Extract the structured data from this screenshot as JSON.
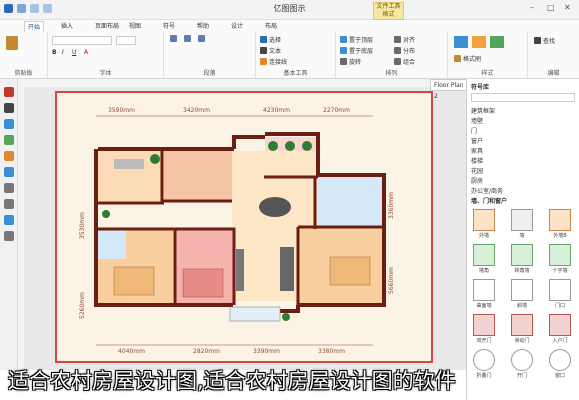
{
  "window": {
    "title": "亿图图示",
    "context_tab": "文件工具\n格式"
  },
  "tabs": {
    "file": "文件",
    "items": [
      "开始",
      "插入",
      "页面布局",
      "视图",
      "符号",
      "帮助",
      "设计",
      "布局"
    ],
    "active": 0
  },
  "ribbon": {
    "groups": [
      "剪贴板",
      "字体",
      "段落",
      "基本工具",
      "排列",
      "样式",
      "编辑"
    ],
    "buttons": [
      "选择",
      "文本",
      "连接线",
      "置于顶层",
      "置于底层",
      "对齐",
      "分布",
      "旋转",
      "组合",
      "格式刷",
      "查找"
    ]
  },
  "document": {
    "tab_label": "Floor Plan Design 2"
  },
  "floorplan": {
    "top_dims": [
      "3590mm",
      "3420mm",
      "4230mm",
      "2270mm"
    ],
    "bottom_dims": [
      "4040mm",
      "2820mm",
      "3390mm",
      "3380mm"
    ],
    "right_dims": [
      "3360mm",
      "5660mm"
    ],
    "left_dims": [
      "3530mm",
      "5260mm"
    ]
  },
  "right_panel": {
    "title": "符号库",
    "search_placeholder": "搜索",
    "categories": [
      "建筑框架",
      "墙壁",
      "门",
      "窗户",
      "家具",
      "楼梯",
      "花园",
      "厨房",
      "办公室/商务",
      "墙、门和窗户"
    ],
    "symbols": [
      "外墙",
      "墙",
      "外墙B",
      "墙角",
      "转角墙",
      "十字墙",
      "曲面墙",
      "斜墙",
      "门口",
      "双开门",
      "滑动门",
      "入户门",
      "折叠门",
      "开门",
      "窗口",
      "窗户"
    ]
  },
  "caption": {
    "text": "适合农村房屋设计图,适合农村房屋设计图的软件"
  },
  "colors": {
    "accent": "#2b6cb8",
    "wall": "#6b1e12",
    "border_red": "#d64545",
    "page_bg": "#fbf3e6"
  }
}
